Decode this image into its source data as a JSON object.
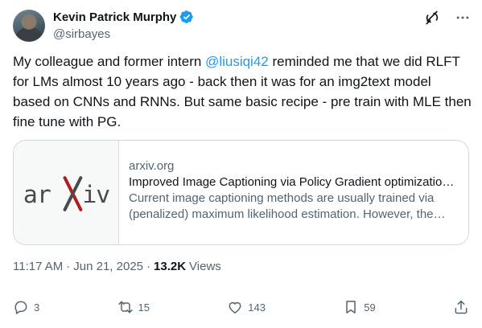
{
  "author": {
    "display_name": "Kevin Patrick Murphy",
    "handle": "@sirbayes"
  },
  "tweet": {
    "text_before": "My colleague and former intern ",
    "mention": "@liusiqi42",
    "text_after": " reminded me that we did RLFT for LMs almost 10 years ago - back then it was for an img2text model based on CNNs and RNNs. But same basic recipe - pre train with MLE then fine tune with PG."
  },
  "card": {
    "logo_text": "arXiv",
    "domain": "arxiv.org",
    "title": "Improved Image Captioning via Policy Gradient optimization of SPIDEr",
    "description": "Current image captioning methods are usually trained via (penalized) maximum likelihood estimation. However, the progress made in captioning"
  },
  "meta": {
    "time": "11:17 AM",
    "separator": "·",
    "date": "Jun 21, 2025",
    "views_count": "13.2K",
    "views_label": "Views"
  },
  "actions": {
    "replies": "3",
    "reposts": "15",
    "likes": "143",
    "bookmarks": "59"
  },
  "colors": {
    "accent": "#1d9bf0",
    "secondary_text": "#536471",
    "border": "#cfd9de",
    "arxiv_red": "#b31b1b"
  },
  "icons": {
    "verified": "verified-badge-icon",
    "grok": "grok-icon",
    "more": "more-icon",
    "reply": "reply-icon",
    "repost": "repost-icon",
    "like": "heart-icon",
    "bookmark": "bookmark-icon",
    "share": "share-icon"
  }
}
